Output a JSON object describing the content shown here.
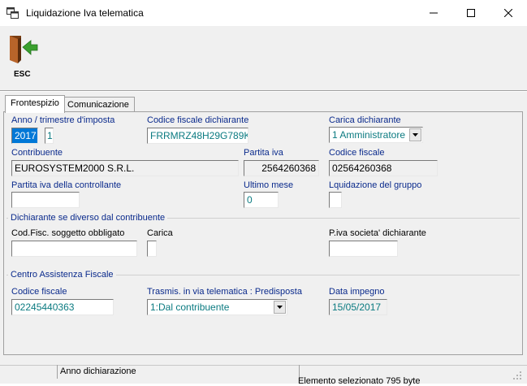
{
  "window": {
    "title": "Liquidazione Iva telematica",
    "minimize_icon": "minimize-icon",
    "maximize_icon": "maximize-icon",
    "close_icon": "close-icon"
  },
  "toolbar": {
    "esc_label": "ESC",
    "esc_icon": "exit-door-icon"
  },
  "tabs": [
    {
      "label": "Frontespizio",
      "active": true
    },
    {
      "label": "Comunicazione",
      "active": false
    }
  ],
  "form": {
    "anno_label": "Anno / trimestre d'imposta",
    "anno_value": "2017",
    "trimestre_value": "1",
    "cf_dichiarante_label": "Codice fiscale dichiarante",
    "cf_dichiarante_value": "FRRMRZ48H29G789K",
    "carica_dichiarante_label": "Carica dichiarante",
    "carica_dichiarante_value": "1 Amministratore",
    "contribuente_label": "Contribuente",
    "contribuente_value": "EUROSYSTEM2000 S.R.L.",
    "partita_iva_label": "Partita iva",
    "partita_iva_value": "2564260368",
    "codice_fiscale_label": "Codice fiscale",
    "codice_fiscale_value": "02564260368",
    "piva_controllante_label": "Partita iva della controllante",
    "piva_controllante_value": "",
    "ultimo_mese_label": "Ultimo mese",
    "ultimo_mese_value": "0",
    "liquidazione_gruppo_label": "Lquidazione del gruppo",
    "liquidazione_gruppo_value": ""
  },
  "dichiarante_group": {
    "title": "Dichiarante se diverso dal contribuente",
    "cf_soggetto_label": "Cod.Fisc. soggetto obbligato",
    "cf_soggetto_value": "",
    "carica_label": "Carica",
    "carica_value": "",
    "piva_societa_label": "P.iva societa' dichiarante",
    "piva_societa_value": ""
  },
  "caf_group": {
    "title": "Centro Assistenza Fiscale",
    "codice_fiscale_label": "Codice fiscale",
    "codice_fiscale_value": "02245440363",
    "trasmis_label": "Trasmis. in via telematica : Predisposta",
    "trasmis_value": "1:Dal contribuente",
    "data_impegno_label": "Data impegno",
    "data_impegno_value": "15/05/2017"
  },
  "statusbar": {
    "text": "Anno dichiarazione",
    "behind_text": "Elemento selezionato 795 byte"
  },
  "colors": {
    "label_blue": "#0a2a8c",
    "value_teal": "#0a7a80",
    "selection": "#0078d7",
    "panel": "#f0f0f0"
  }
}
